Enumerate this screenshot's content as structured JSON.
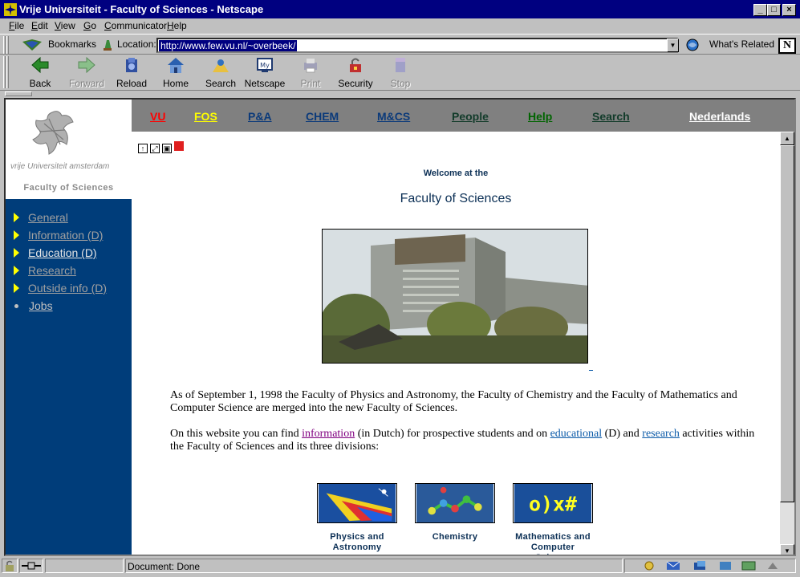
{
  "window": {
    "title": "Vrije Universiteit - Faculty of Sciences - Netscape",
    "minimize": "_",
    "maximize": "□",
    "close": "×"
  },
  "menu": [
    "File",
    "Edit",
    "View",
    "Go",
    "Communicator",
    "Help"
  ],
  "location_bar": {
    "bookmarks": "Bookmarks",
    "location_label": "Location:",
    "url": "http://www.few.vu.nl/~overbeek/",
    "whats_related": "What's Related",
    "brand_logo": "N"
  },
  "toolbar": {
    "back": "Back",
    "forward": "Forward",
    "reload": "Reload",
    "home": "Home",
    "search": "Search",
    "netscape": "Netscape",
    "print": "Print",
    "security": "Security",
    "stop": "Stop"
  },
  "logo": {
    "university": "vrije Universiteit  amsterdam",
    "faculty": "Faculty of Sciences"
  },
  "topnav": [
    {
      "label": "VU",
      "color": "#ff0000"
    },
    {
      "label": "FOS",
      "color": "#ffff00"
    },
    {
      "label": "P&A",
      "color": "#0b3a7a"
    },
    {
      "label": "CHEM",
      "color": "#0b3a7a"
    },
    {
      "label": "M&CS",
      "color": "#0b3a7a"
    },
    {
      "label": "People",
      "color": "#123b2a"
    },
    {
      "label": "Help",
      "color": "#006400"
    },
    {
      "label": "Search",
      "color": "#123b2a"
    },
    {
      "label": "Nederlands",
      "color": "#ffffff"
    }
  ],
  "sidebar": [
    {
      "label": "General",
      "color": "#a0a0a0"
    },
    {
      "label": "Information (D)",
      "color": "#a0a0a0"
    },
    {
      "label": "Education (D)",
      "color": "#e6e6e6"
    },
    {
      "label": "Research",
      "color": "#a0a0a0"
    },
    {
      "label": "Outside info (D)",
      "color": "#a0a0a0"
    },
    {
      "label": "Jobs",
      "color": "#c0c0c0"
    }
  ],
  "content": {
    "welcome": "Welcome at the",
    "title": "Faculty of Sciences",
    "para1": "As of September 1, 1998 the Faculty of Physics and Astronomy, the Faculty of Chemistry and the Faculty of Mathematics and Computer Science are merged into the new Faculty of Sciences.",
    "para2_a": "On this website you can find ",
    "link_information": "information",
    "para2_b": " (in Dutch) for prospective students and on ",
    "link_educational": "educational",
    "para2_c": " (D) and ",
    "link_research": "research",
    "para2_d": " activities within the Faculty of Sciences and its three divisions:",
    "divisions": [
      {
        "line1": "Physics and",
        "line2": "Astronomy"
      },
      {
        "line1": "Chemistry",
        "line2": ""
      },
      {
        "line1": "Mathematics and",
        "line2": "Computer Science"
      }
    ]
  },
  "status": {
    "text": "Document: Done"
  },
  "colors": {
    "titlebar": "#000080",
    "sidebar": "#003d7a",
    "navbar": "#808080",
    "accent_text": "#0b2f55",
    "link_visited": "#800080",
    "link": "#0b5aa8"
  }
}
